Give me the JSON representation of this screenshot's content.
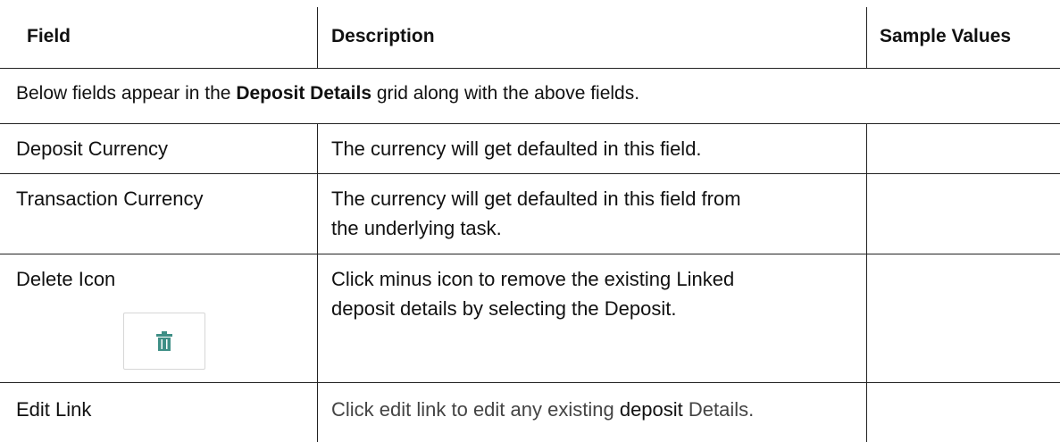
{
  "table": {
    "headers": {
      "field": "Field",
      "description": "Description",
      "sample_values": "Sample Values"
    },
    "note": {
      "prefix": "Below fields appear in the ",
      "bold": "Deposit Details",
      "suffix": " grid along with the above fields."
    },
    "rows": [
      {
        "field": "Deposit Currency",
        "description": "The currency will get defaulted in this field."
      },
      {
        "field": "Transaction Currency",
        "description_line1": "The currency will get defaulted in this field from",
        "description_line2": "the underlying task."
      },
      {
        "field": "Delete Icon",
        "description_line1": "Click minus icon to remove the existing Linked",
        "description_line2": "deposit details by selecting the Deposit.",
        "icon": "trash-icon"
      },
      {
        "field": "Edit Link",
        "description_part1": "Click edit link to edit any existing ",
        "description_part2": "deposit",
        "description_part3": " Details."
      }
    ]
  },
  "colors": {
    "trash_icon": "#3f8f86",
    "border": "#222222",
    "icon_box_border": "#d6d6d6"
  }
}
